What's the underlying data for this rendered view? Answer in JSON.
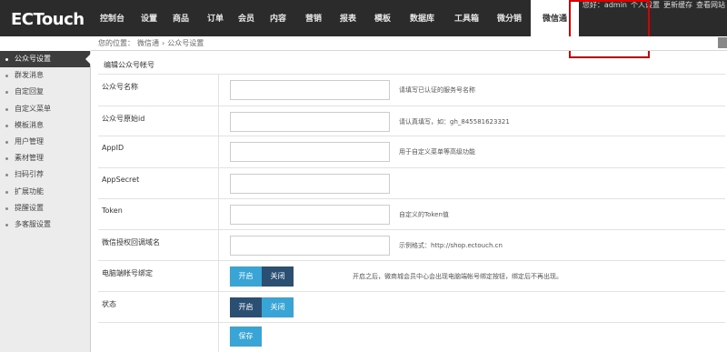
{
  "logo": "ECTouch",
  "nav": [
    {
      "label": "控制台",
      "name": "nav-dashboard",
      "w": 47
    },
    {
      "label": "设置",
      "name": "nav-settings",
      "w": 34
    },
    {
      "label": "商品",
      "name": "nav-goods",
      "w": 36
    },
    {
      "label": "订单",
      "name": "nav-orders",
      "w": 40
    },
    {
      "label": "会员",
      "name": "nav-members",
      "w": 28
    },
    {
      "label": "内容",
      "name": "nav-content",
      "w": 42
    },
    {
      "label": "营销",
      "name": "nav-marketing",
      "w": 36
    },
    {
      "label": "报表",
      "name": "nav-reports",
      "w": 40
    },
    {
      "label": "模板",
      "name": "nav-templates",
      "w": 36
    },
    {
      "label": "数据库",
      "name": "nav-database",
      "w": 51
    },
    {
      "label": "工具箱",
      "name": "nav-toolbox",
      "w": 47
    },
    {
      "label": "微分销",
      "name": "nav-distribution",
      "w": 47
    },
    {
      "label": "微信通",
      "name": "nav-wechat",
      "w": 53,
      "active": true
    }
  ],
  "top_links": [
    "您好：admin",
    "个人设置",
    "更新缓存",
    "查看网站"
  ],
  "breadcrumb": {
    "prefix": "您的位置：",
    "parent": "微信通",
    "sep": "›",
    "current": "公众号设置"
  },
  "sidebar": [
    {
      "label": "公众号设置",
      "active": true
    },
    {
      "label": "群发消息"
    },
    {
      "label": "自定回复"
    },
    {
      "label": "自定义菜单"
    },
    {
      "label": "模板消息"
    },
    {
      "label": "用户管理"
    },
    {
      "label": "素材管理"
    },
    {
      "label": "扫码引荐"
    },
    {
      "label": "扩展功能"
    },
    {
      "label": "提醒设置"
    },
    {
      "label": "多客服设置"
    }
  ],
  "form": {
    "title": "编辑公众号帐号",
    "rows": [
      {
        "label": "公众号名称",
        "value": "",
        "hint": "请填写已认证的服务号名称"
      },
      {
        "label": "公众号原始id",
        "value": "",
        "hint": "请认真填写，如：gh_845581623321"
      },
      {
        "label": "AppID",
        "value": "",
        "hint": "用于自定义菜单等高级功能"
      },
      {
        "label": "AppSecret",
        "value": "",
        "hint": ""
      },
      {
        "label": "Token",
        "value": "",
        "hint": "自定义的Token值"
      },
      {
        "label": "微信授权回调域名",
        "value": "",
        "hint": "示例格式：http://shop.ectouch.cn"
      }
    ],
    "bind_label": "电脑端帐号绑定",
    "bind_on": "开启",
    "bind_off": "关闭",
    "bind_hint": "开启之后，微商城会员中心会出现电脑端帐号绑定按钮，绑定后不再出现。",
    "status_label": "状态",
    "status_on": "开启",
    "status_off": "关闭",
    "save": "保存"
  }
}
